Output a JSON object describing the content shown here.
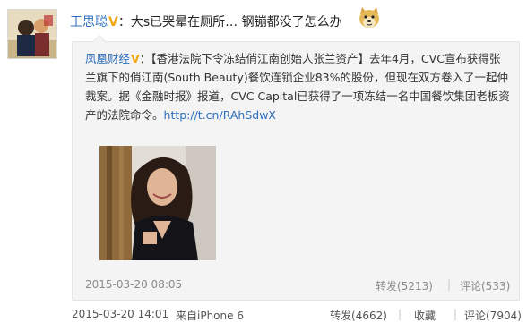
{
  "post": {
    "author": "王思聪",
    "vbadge": "V",
    "colon": "：",
    "text": "大s已哭晕在厕所… 钢镚都没了怎么办"
  },
  "repost": {
    "author": "凤凰财经",
    "vbadge": "V",
    "colon": "：",
    "text": "【香港法院下令冻结俏江南创始人张兰资产】去年4月，CVC宣布获得张兰旗下的俏江南(South Beauty)餐饮连锁企业83%的股份，但现在双方卷入了一起仲裁案。据《金融时报》报道，CVC Capital已获得了一项冻结一名中国餐饮集团老板资产的法院命令。",
    "link": "http://t.cn/RAhSdwX",
    "time": "2015-03-20 08:05",
    "repost_count": "转发(5213)",
    "comment_count": "评论(533)",
    "sep": "|"
  },
  "footer": {
    "time": "2015-03-20 14:01",
    "source": "来自iPhone 6",
    "repost": "转发(4662)",
    "favorite": "收藏",
    "comment": "评论(7904)",
    "sep": "|"
  },
  "colors": {
    "link_blue": "#2d6fbd",
    "vbadge_gold": "#f2a613",
    "meta_gray": "#8a8a8a",
    "repost_bg": "#f4f4f4"
  },
  "icons": {
    "emoji": "doge-emoji-icon"
  }
}
